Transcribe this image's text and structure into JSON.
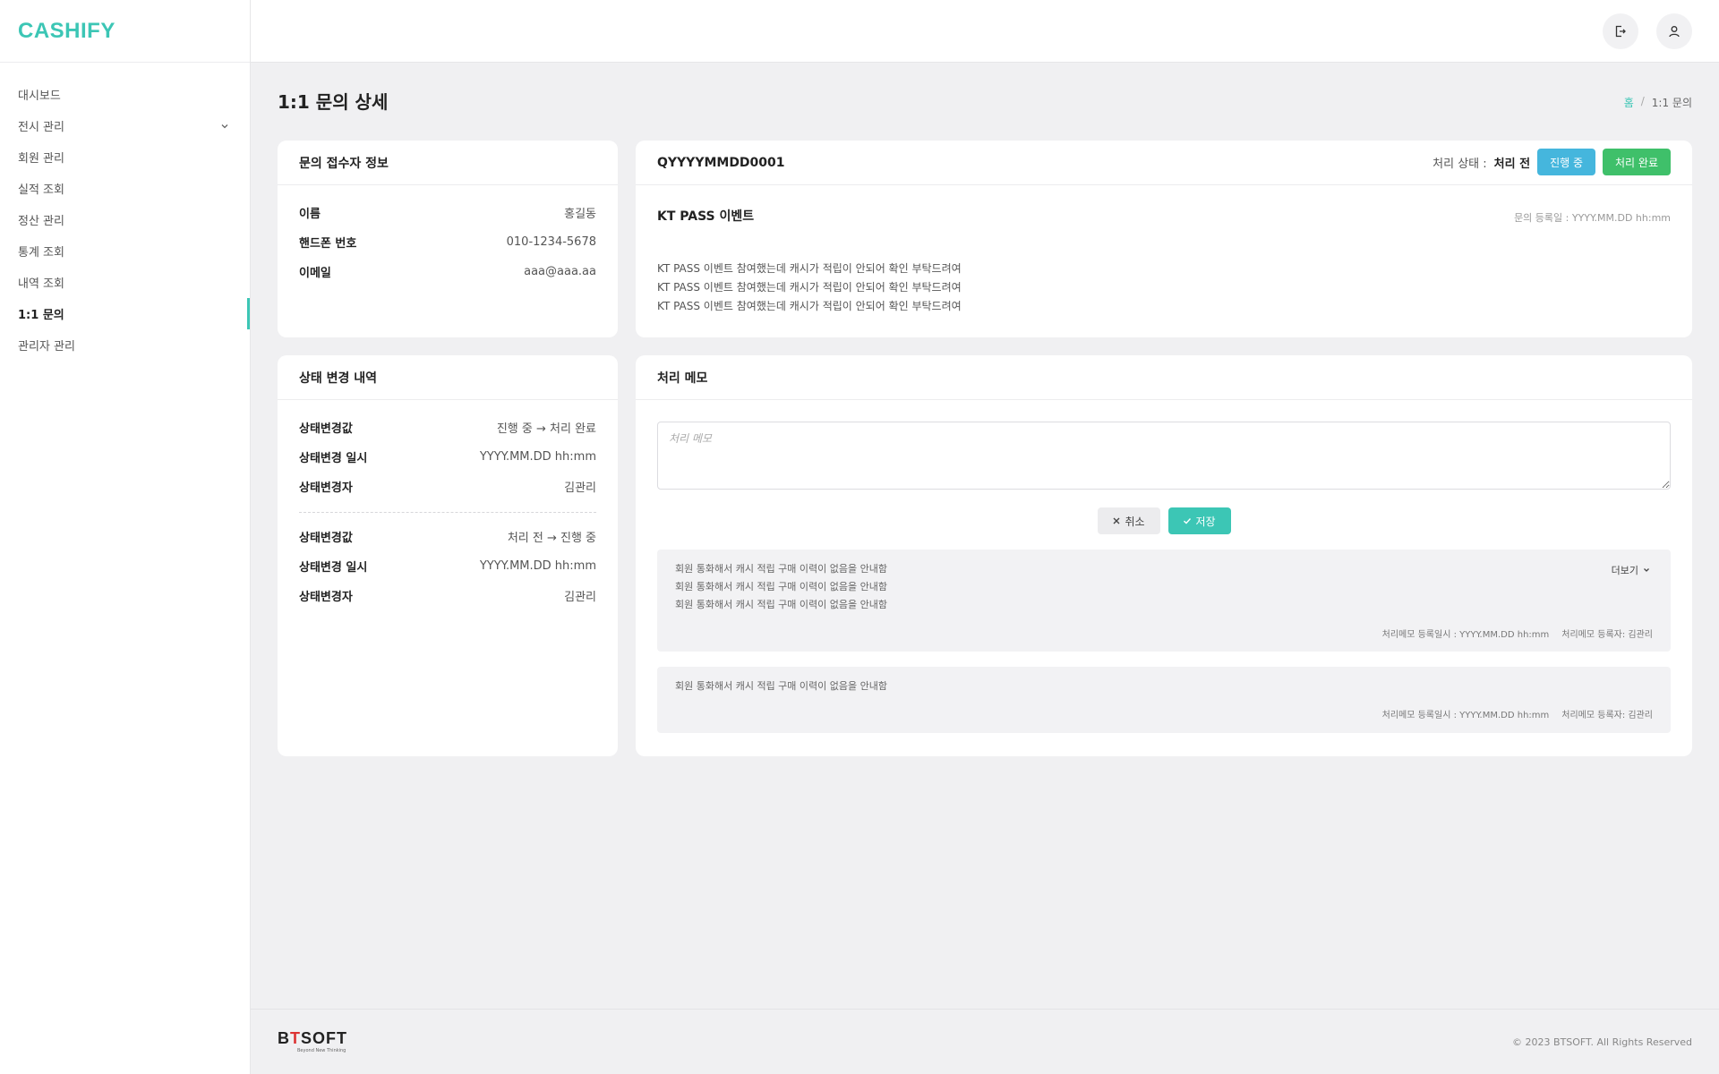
{
  "app": {
    "logo": "CASHIFY"
  },
  "sidebar": {
    "items": [
      {
        "label": "대시보드"
      },
      {
        "label": "전시 관리"
      },
      {
        "label": "회원 관리"
      },
      {
        "label": "실적 조회"
      },
      {
        "label": "정산 관리"
      },
      {
        "label": "통계 조회"
      },
      {
        "label": "내역 조회"
      },
      {
        "label": "1:1 문의"
      },
      {
        "label": "관리자 관리"
      }
    ],
    "active_index": 7,
    "accent_color": "#3cc6b5"
  },
  "header": {
    "icons": [
      "logout-icon",
      "user-icon"
    ]
  },
  "page": {
    "title": "1:1 문의 상세",
    "breadcrumb": {
      "home": "홈",
      "sep": "/",
      "current": "1:1 문의"
    }
  },
  "requester": {
    "title": "문의 접수자 정보",
    "rows": [
      {
        "k": "이름",
        "v": "홍길동"
      },
      {
        "k": "핸드폰 번호",
        "v": "010-1234-5678"
      },
      {
        "k": "이메일",
        "v": "aaa@aaa.aa"
      }
    ]
  },
  "inquiry": {
    "id": "QYYYYMMDD0001",
    "status_label": "처리 상태 :",
    "status_value": "처리 전",
    "btn_progress": "진행 중",
    "btn_done": "처리 완료",
    "title": "KT PASS 이벤트",
    "date": "문의 등록일 : YYYY.MM.DD hh:mm",
    "body": [
      "KT PASS 이벤트 참여했는데 캐시가 적립이 안되어 확인 부탁드려여",
      "KT PASS 이벤트 참여했는데 캐시가 적립이 안되어 확인 부탁드려여",
      "KT PASS 이벤트 참여했는데 캐시가 적립이 안되어 확인 부탁드려여"
    ],
    "colors": {
      "progress": "#45b6dd",
      "done": "#3fc06a"
    }
  },
  "history": {
    "title": "상태 변경 내역",
    "groups": [
      {
        "rows": [
          {
            "k": "상태변경값",
            "v": "진행 중 → 처리 완료"
          },
          {
            "k": "상태변경 일시",
            "v": "YYYY.MM.DD hh:mm"
          },
          {
            "k": "상태변경자",
            "v": "김관리"
          }
        ]
      },
      {
        "rows": [
          {
            "k": "상태변경값",
            "v": "처리 전 → 진행 중"
          },
          {
            "k": "상태변경 일시",
            "v": "YYYY.MM.DD hh:mm"
          },
          {
            "k": "상태변경자",
            "v": "김관리"
          }
        ]
      }
    ]
  },
  "memo": {
    "title": "처리 메모",
    "placeholder": "처리 메모",
    "cancel": "취소",
    "save": "저장",
    "more": "더보기",
    "entries": [
      {
        "lines": [
          "회원 통화해서 캐시 적립 구매 이력이 없음을 안내함",
          "회원 통화해서 캐시 적립 구매 이력이 없음을 안내함",
          "회원 통화해서 캐시 적립 구매 이력이 없음을 안내함"
        ],
        "date": "처리메모 등록일시 : YYYY.MM.DD hh:mm",
        "author": "처리메모 등록자: 김관리"
      },
      {
        "lines": [
          "회원 통화해서 캐시 적립 구매 이력이 없음을 안내함"
        ],
        "date": "처리메모 등록일시 : YYYY.MM.DD hh:mm",
        "author": "처리메모 등록자: 김관리"
      }
    ]
  },
  "footer": {
    "brand_b": "B",
    "brand_t": "T",
    "brand_rest": "SOFT",
    "tagline": "Beyond New Thinking",
    "copyright": "© 2023 BTSOFT. All Rights Reserved"
  }
}
